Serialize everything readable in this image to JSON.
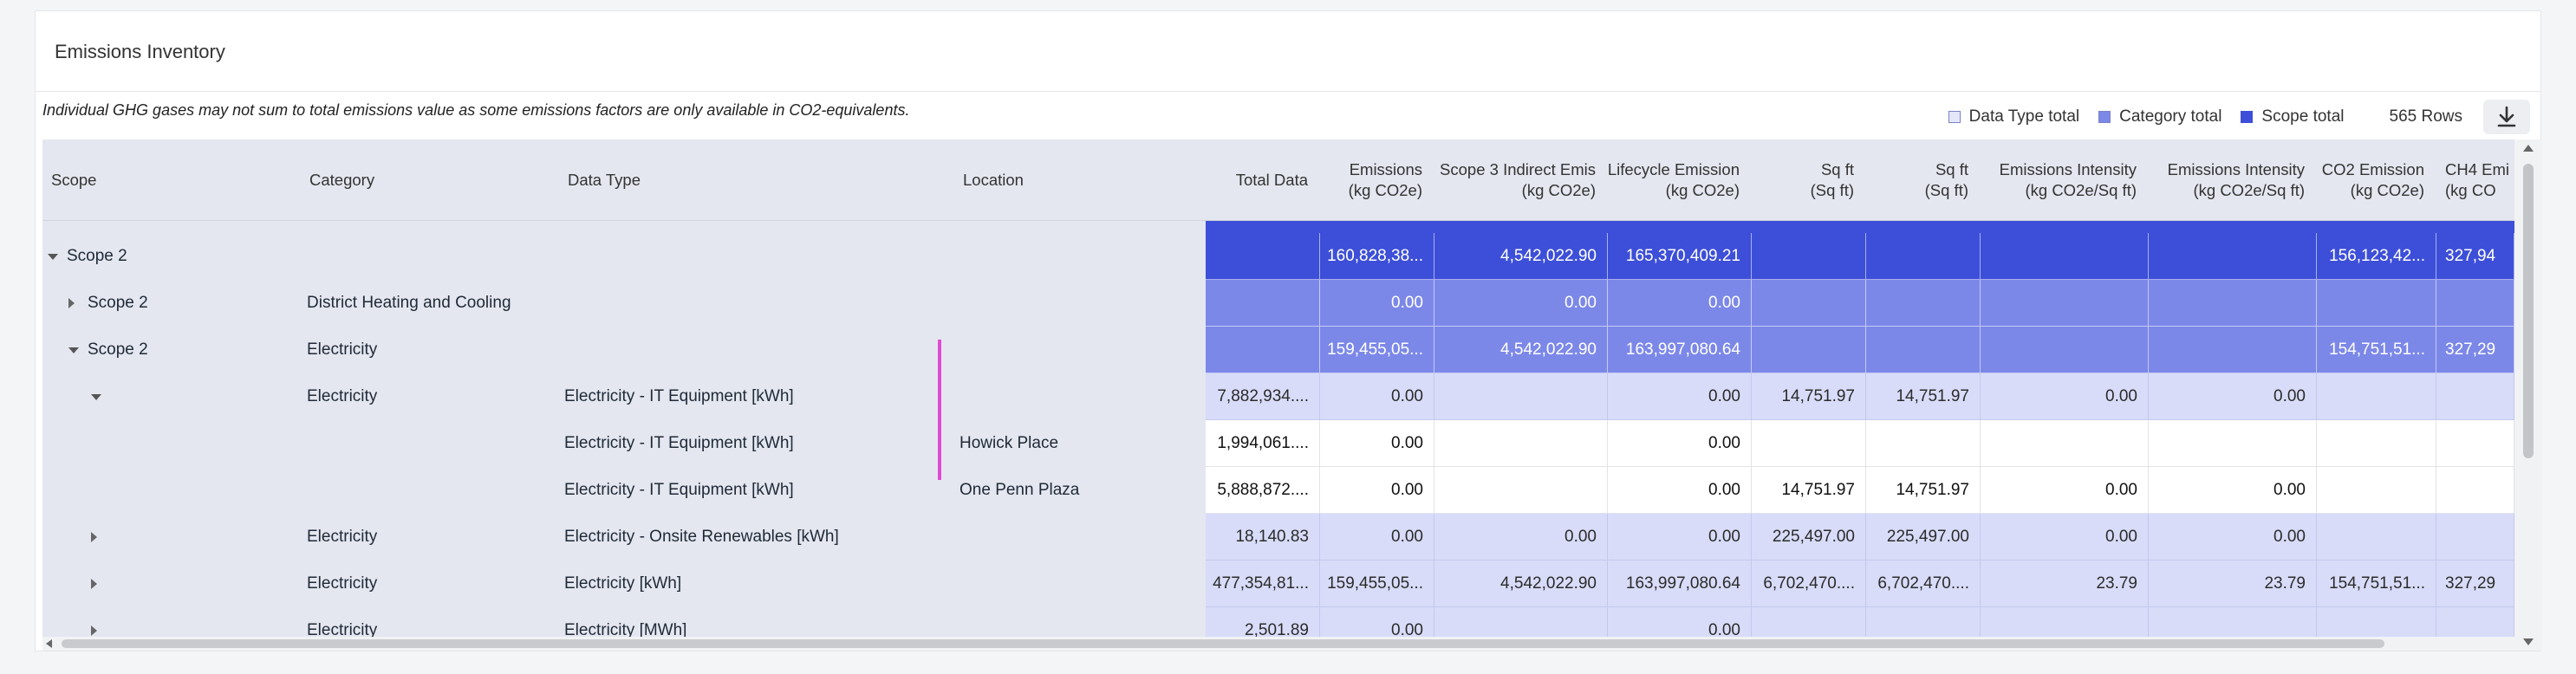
{
  "panel": {
    "title": "Emissions Inventory",
    "note": "Individual GHG gases may not sum to total emissions value as some emissions factors are only available in CO2-equivalents."
  },
  "legend": {
    "items": [
      {
        "label": "Data Type total",
        "color": "#d8dcf8"
      },
      {
        "label": "Category total",
        "color": "#7c88e8"
      },
      {
        "label": "Scope total",
        "color": "#3d4fd8"
      }
    ],
    "rows_label": "565 Rows",
    "download_icon": "download-icon"
  },
  "columns": {
    "scope": "Scope",
    "category": "Category",
    "data_type": "Data Type",
    "location": "Location",
    "numeric": [
      {
        "line1": "Total Data",
        "line2": ""
      },
      {
        "line1": "Emissions",
        "line2": "(kg CO2e)"
      },
      {
        "line1": "Scope 3 Indirect Emis",
        "line2": "(kg CO2e)"
      },
      {
        "line1": "Lifecycle Emission",
        "line2": "(kg CO2e)"
      },
      {
        "line1": "Sq ft",
        "line2": "(Sq ft)"
      },
      {
        "line1": "Sq ft",
        "line2": "(Sq ft)"
      },
      {
        "line1": "Emissions Intensity",
        "line2": "(kg CO2e/Sq ft)"
      },
      {
        "line1": "Emissions Intensity",
        "line2": "(kg CO2e/Sq ft)"
      },
      {
        "line1": "CO2 Emission",
        "line2": "(kg CO2e)"
      },
      {
        "line1": "CH4 Emi",
        "line2": "(kg CO"
      }
    ]
  },
  "rows": [
    {
      "level": "scope",
      "toggle": "expanded",
      "scope": "Scope 2",
      "category": "",
      "data_type": "",
      "location": "",
      "values": [
        "",
        "160,828,38...",
        "4,542,022.90",
        "165,370,409.21",
        "",
        "",
        "",
        "",
        "156,123,42...",
        "327,94"
      ]
    },
    {
      "level": "cat",
      "toggle": "collapsed",
      "scope": "Scope 2",
      "category": "District Heating and Cooling",
      "data_type": "",
      "location": "",
      "values": [
        "",
        "0.00",
        "0.00",
        "0.00",
        "",
        "",
        "",
        "",
        "",
        ""
      ]
    },
    {
      "level": "cat",
      "toggle": "expanded",
      "scope": "Scope 2",
      "category": "Electricity",
      "data_type": "",
      "location": "",
      "values": [
        "",
        "159,455,05...",
        "4,542,022.90",
        "163,997,080.64",
        "",
        "",
        "",
        "",
        "154,751,51...",
        "327,29"
      ]
    },
    {
      "level": "dt",
      "toggle": "expanded",
      "scope": "",
      "category": "Electricity",
      "data_type": "Electricity - IT Equipment [kWh]",
      "location": "",
      "values": [
        "7,882,934....",
        "0.00",
        "",
        "0.00",
        "14,751.97",
        "14,751.97",
        "0.00",
        "0.00",
        "",
        ""
      ]
    },
    {
      "level": "loc",
      "toggle": "",
      "scope": "",
      "category": "",
      "data_type": "Electricity - IT Equipment [kWh]",
      "location": "Howick Place",
      "values": [
        "1,994,061....",
        "0.00",
        "",
        "0.00",
        "",
        "",
        "",
        "",
        "",
        ""
      ]
    },
    {
      "level": "loc",
      "toggle": "",
      "scope": "",
      "category": "",
      "data_type": "Electricity - IT Equipment [kWh]",
      "location": "One Penn Plaza",
      "values": [
        "5,888,872....",
        "0.00",
        "",
        "0.00",
        "14,751.97",
        "14,751.97",
        "0.00",
        "0.00",
        "",
        ""
      ]
    },
    {
      "level": "dt",
      "toggle": "collapsed",
      "scope": "",
      "category": "Electricity",
      "data_type": "Electricity - Onsite Renewables [kWh]",
      "location": "",
      "values": [
        "18,140.83",
        "0.00",
        "0.00",
        "0.00",
        "225,497.00",
        "225,497.00",
        "0.00",
        "0.00",
        "",
        ""
      ]
    },
    {
      "level": "dt",
      "toggle": "collapsed",
      "scope": "",
      "category": "Electricity",
      "data_type": "Electricity [kWh]",
      "location": "",
      "values": [
        "477,354,81...",
        "159,455,05...",
        "4,542,022.90",
        "163,997,080.64",
        "6,702,470....",
        "6,702,470....",
        "23.79",
        "23.79",
        "154,751,51...",
        "327,29"
      ]
    },
    {
      "level": "dt",
      "toggle": "collapsed",
      "scope": "",
      "category": "Electricity",
      "data_type": "Electricity [MWh]",
      "location": "",
      "values": [
        "2,501.89",
        "0.00",
        "",
        "0.00",
        "",
        "",
        "",
        "",
        "",
        ""
      ]
    }
  ]
}
